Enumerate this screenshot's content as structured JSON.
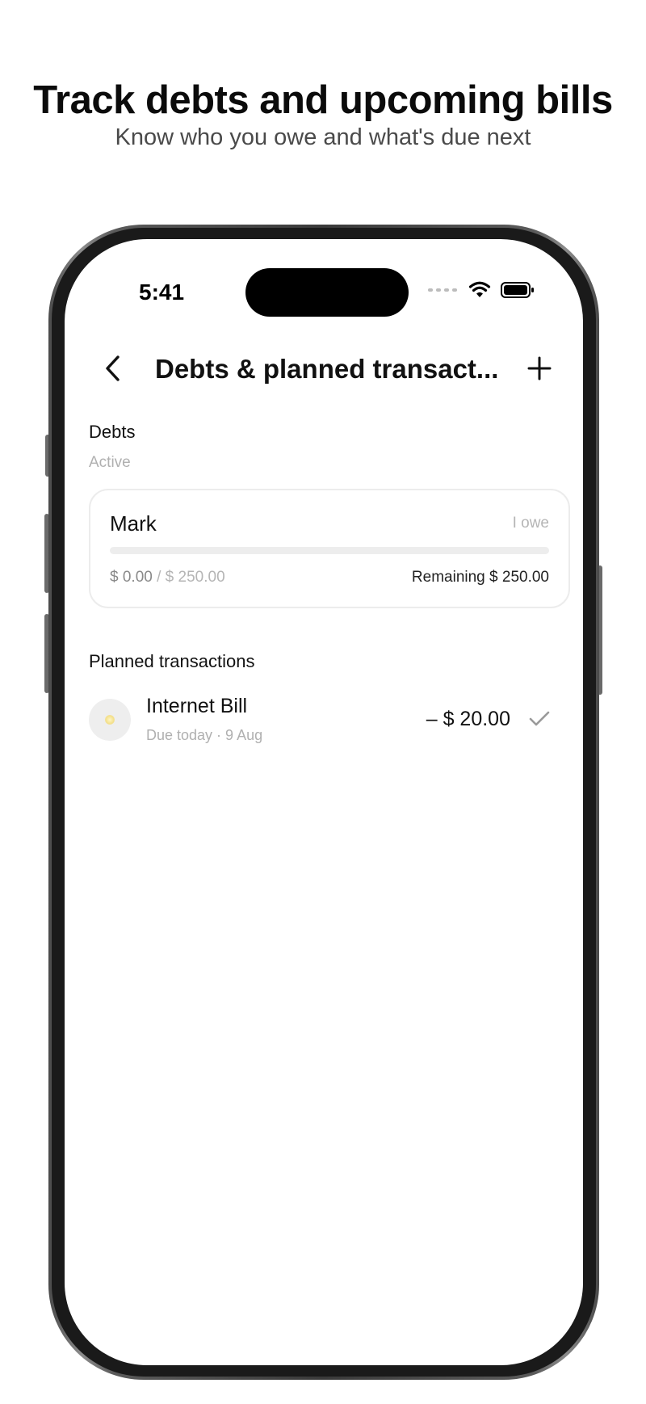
{
  "promo": {
    "title": "Track debts and upcoming bills",
    "subtitle": "Know who you owe and what's due next"
  },
  "status_bar": {
    "time": "5:41"
  },
  "nav": {
    "title": "Debts & planned transact..."
  },
  "debts": {
    "section_title": "Debts",
    "filter_label": "Active",
    "items": [
      {
        "name": "Mark",
        "type": "I owe",
        "paid": "$ 0.00",
        "total": "$ 250.00",
        "remaining": "Remaining $ 250.00",
        "progress_percent": 0
      }
    ]
  },
  "planned": {
    "section_title": "Planned transactions",
    "items": [
      {
        "name": "Internet Bill",
        "due": "Due today · 9 Aug",
        "amount": "– $ 20.00",
        "icon": "lightbulb-icon"
      }
    ]
  },
  "colors": {
    "text_primary": "#111111",
    "text_muted": "#b0b0b0",
    "card_border": "#ececec",
    "progress_track": "#ededed"
  }
}
